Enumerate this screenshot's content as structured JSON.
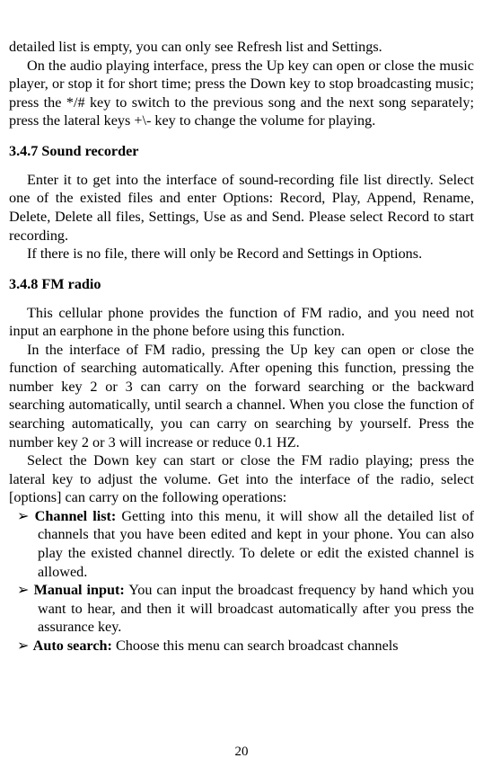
{
  "p1": "detailed list is empty, you can only see Refresh list and Settings.",
  "p2": "On the audio playing interface, press the Up key can open or close the music player, or stop it for short time; press the Down key to stop broadcasting music; press the */# key to switch to the previous song and the next song separately; press the lateral keys +\\- key to change the volume for playing.",
  "h1": "3.4.7 Sound recorder",
  "p3": "Enter it to get into the interface of sound-recording file list directly. Select one of the existed files and enter Options: Record, Play, Append, Rename, Delete, Delete all files, Settings, Use as and Send. Please select Record to start recording.",
  "p4": "If there is no file, there will only be Record and Settings in Options.",
  "h2": "3.4.8 FM radio",
  "p5": "This cellular phone provides the function of FM radio, and you need not input an earphone in the phone before using this function.",
  "p6": "In the interface of FM radio, pressing the Up key can open or close the function of searching automatically. After opening this function, pressing the number key 2 or 3 can carry on the forward searching or the backward searching automatically, until search a channel. When you close the function of searching automatically, you can carry on searching by yourself. Press the number key 2 or 3 will increase or reduce 0.1 HZ.",
  "p7": "Select the Down key can start or close the FM radio playing; press the lateral key to adjust the volume. Get into the interface of the radio, select [options] can carry on the following operations:",
  "li1_label": "Channel list:",
  "li1_text": " Getting into this menu, it will show all the detailed list of channels that you have been edited and kept in your phone. You can also play the existed channel directly. To delete or edit the existed channel is allowed.",
  "li2_label": "Manual input:",
  "li2_text": " You can input the broadcast frequency by hand which you want to hear, and then it will broadcast automatically after you press the assurance key.",
  "li3_label": "Auto search:",
  "li3_text": " Choose this menu can search broadcast channels",
  "page_num": "20",
  "bullet": "➢"
}
